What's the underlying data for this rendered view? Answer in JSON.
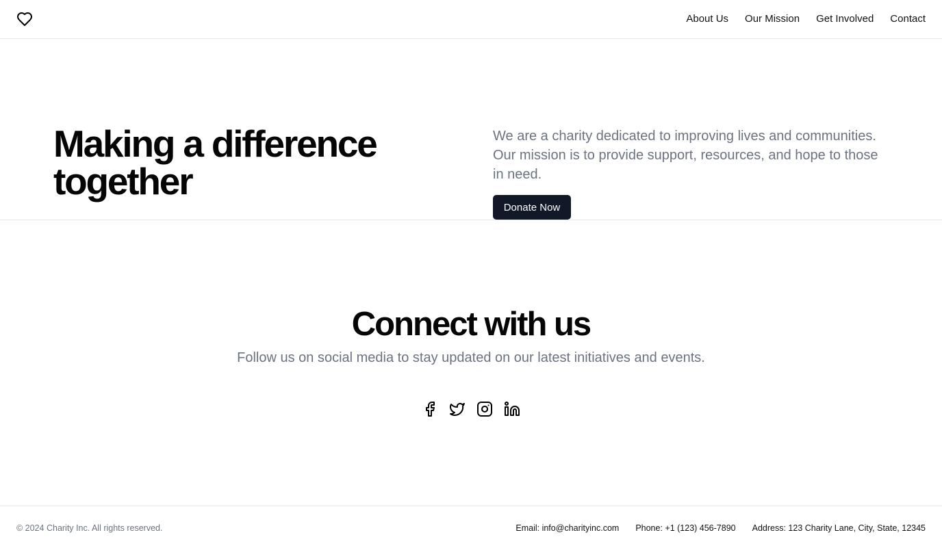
{
  "header": {
    "logo_icon": "heart-icon",
    "nav": [
      {
        "label": "About Us"
      },
      {
        "label": "Our Mission"
      },
      {
        "label": "Get Involved"
      },
      {
        "label": "Contact"
      }
    ]
  },
  "hero": {
    "title": "Making a difference together",
    "description": "We are a charity dedicated to improving lives and communities. Our mission is to provide support, resources, and hope to those in need.",
    "cta_label": "Donate Now"
  },
  "connect": {
    "title": "Connect with us",
    "subtitle": "Follow us on social media to stay updated on our latest initiatives and events.",
    "social_icons": [
      "facebook-icon",
      "twitter-icon",
      "instagram-icon",
      "linkedin-icon"
    ]
  },
  "footer": {
    "copyright": "© 2024 Charity Inc. All rights reserved.",
    "email": "Email: info@charityinc.com",
    "phone": "Phone: +1 (123) 456-7890",
    "address": "Address: 123 Charity Lane, City, State, 12345"
  },
  "colors": {
    "primary_button": "#111827",
    "muted_text": "#6b7280",
    "border": "#e5e7eb"
  }
}
